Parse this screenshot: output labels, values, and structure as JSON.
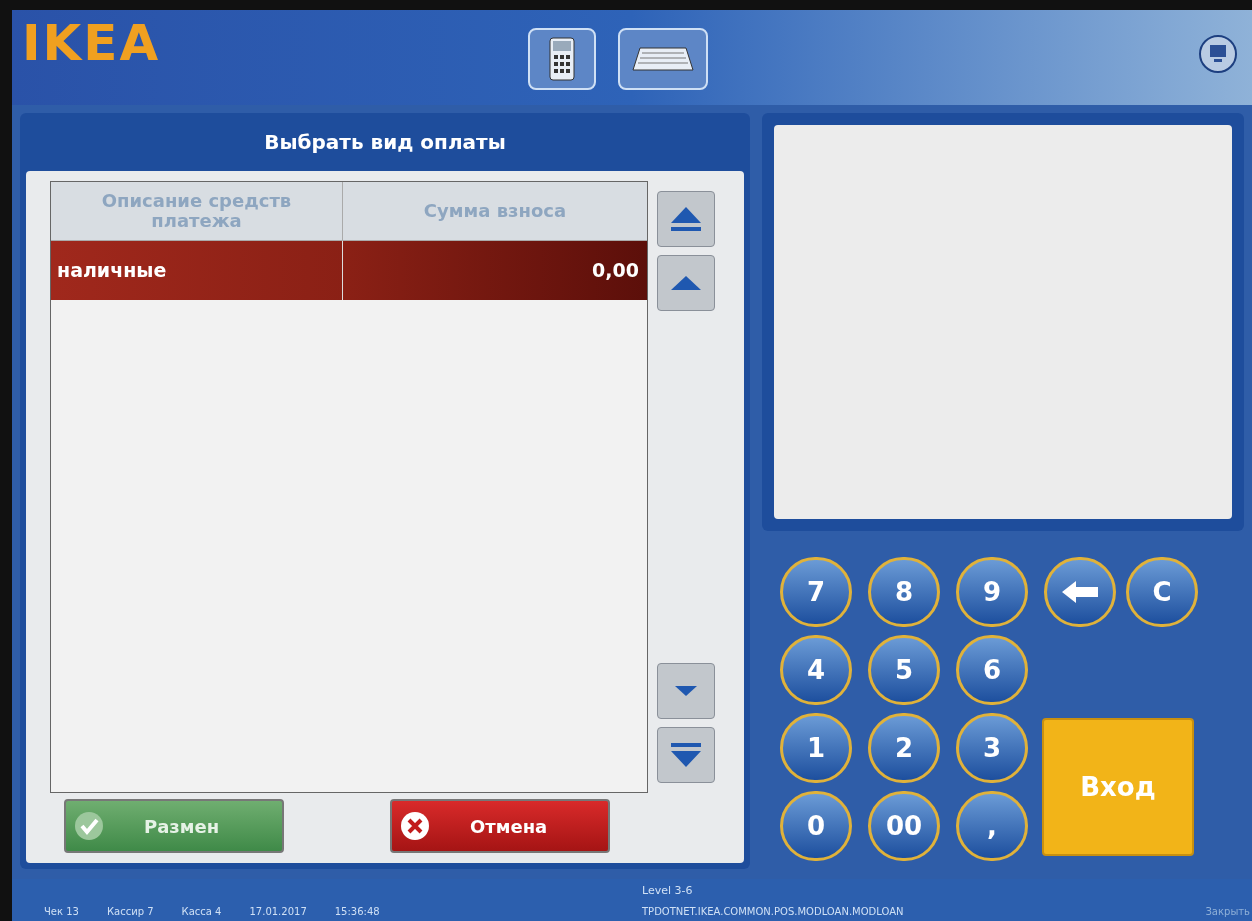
{
  "header": {
    "logo": "IKEA",
    "tools": [
      {
        "kind": "calculator"
      },
      {
        "kind": "keyboard"
      }
    ]
  },
  "payment_panel": {
    "title": "Выбрать вид оплаты",
    "table": {
      "columns": [
        "Описание средств платежа",
        "Сумма взноса"
      ],
      "rows": [
        {
          "cells": [
            "наличные",
            "0,00"
          ],
          "selected": true
        }
      ]
    },
    "scroll_buttons": [
      {
        "kind": "top"
      },
      {
        "kind": "up"
      },
      {
        "kind": "down"
      },
      {
        "kind": "bottom"
      }
    ],
    "buttons": [
      {
        "label": "Размен",
        "kind": "ok"
      },
      {
        "label": "Отмена",
        "kind": "cancel"
      }
    ]
  },
  "keypad": {
    "keys": [
      {
        "label": "7",
        "kind": "digit"
      },
      {
        "label": "8",
        "kind": "digit"
      },
      {
        "label": "9",
        "kind": "digit"
      },
      {
        "kind": "backspace"
      },
      {
        "label": "C",
        "kind": "digit"
      },
      {
        "label": "4",
        "kind": "digit"
      },
      {
        "label": "5",
        "kind": "digit"
      },
      {
        "label": "6",
        "kind": "digit"
      },
      {
        "label": "1",
        "kind": "digit"
      },
      {
        "label": "2",
        "kind": "digit"
      },
      {
        "label": "3",
        "kind": "digit"
      },
      {
        "label": "0",
        "kind": "digit"
      },
      {
        "label": "00",
        "kind": "digit"
      },
      {
        "label": ",",
        "kind": "digit"
      }
    ],
    "enter": "Вход"
  },
  "status_bar": {
    "items": [
      "Чек 13",
      "Кассир 7",
      "Касса 4",
      "17.01.2017",
      "15:36:48"
    ],
    "level": "Level 3-6",
    "module": "TPDOTNET.IKEA.COMMON.POS.MODLOAN.MODLOAN",
    "close": "Закрыть"
  }
}
